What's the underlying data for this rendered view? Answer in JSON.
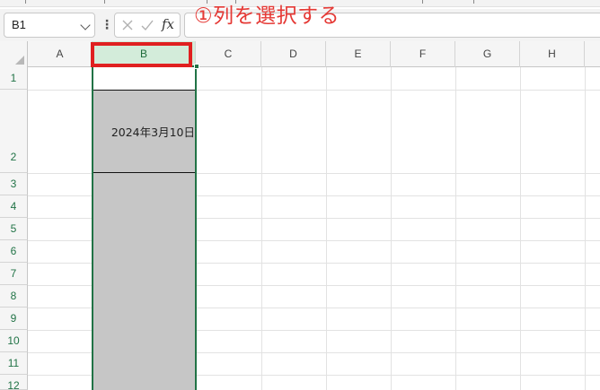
{
  "name_box": {
    "value": "B1"
  },
  "formula_bar": {
    "fx": "fx",
    "annotation": "①列を選択する"
  },
  "columns": [
    "A",
    "B",
    "C",
    "D",
    "E",
    "F",
    "G",
    "H"
  ],
  "selected_column": "B",
  "rows": [
    "1",
    "2",
    "3",
    "4",
    "5",
    "6",
    "7",
    "8",
    "9",
    "10",
    "11",
    "12"
  ],
  "cells": {
    "B2": "2024年3月10日"
  },
  "colors": {
    "accent": "#217346",
    "annotation": "#e53935",
    "selection": "#c6c6c6"
  }
}
